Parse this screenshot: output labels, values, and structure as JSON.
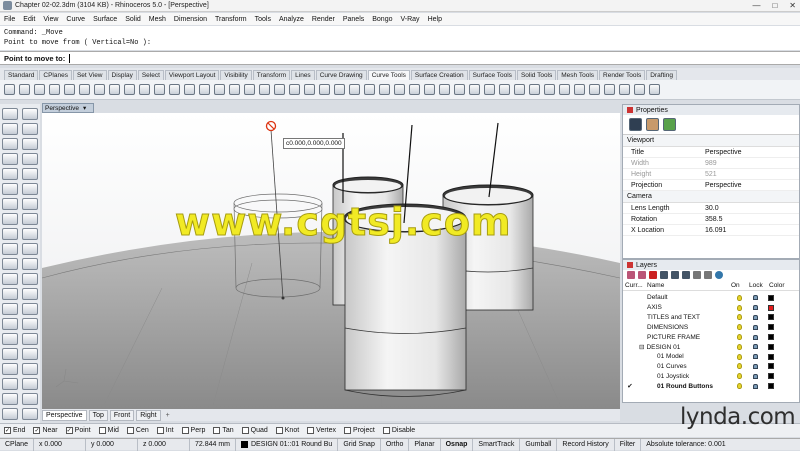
{
  "window": {
    "title": "Chapter 02-02.3dm (3104 KB) - Rhinoceros 5.0 - [Perspective]",
    "controls": [
      "—",
      "□",
      "✕"
    ]
  },
  "menu": [
    "File",
    "Edit",
    "View",
    "Curve",
    "Surface",
    "Solid",
    "Mesh",
    "Dimension",
    "Transform",
    "Tools",
    "Analyze",
    "Render",
    "Panels",
    "Bongo",
    "V-Ray",
    "Help"
  ],
  "command": {
    "history": [
      "Command: _Move",
      "Point to move from ( Vertical=No ):"
    ],
    "prompt": "Point to move to:"
  },
  "toolbar_tabs": [
    "Standard",
    "CPlanes",
    "Set View",
    "Display",
    "Select",
    "Viewport Layout",
    "Visibility",
    "Transform",
    "Lines",
    "Curve Drawing",
    "Curve Tools",
    "Surface Creation",
    "Surface Tools",
    "Solid Tools",
    "Mesh Tools",
    "Render Tools",
    "Drafting"
  ],
  "active_toolbar_tab": "Curve Tools",
  "viewport": {
    "label": "Perspective",
    "coord_tooltip": "c0.000,0.000,0.000",
    "watermark": "www.cgtsj.com",
    "tabs": [
      "Perspective",
      "Top",
      "Front",
      "Right"
    ],
    "add_tab": "+"
  },
  "osnap": [
    {
      "label": "End",
      "checked": true
    },
    {
      "label": "Near",
      "checked": true
    },
    {
      "label": "Point",
      "checked": true
    },
    {
      "label": "Mid",
      "checked": false
    },
    {
      "label": "Cen",
      "checked": false
    },
    {
      "label": "Int",
      "checked": false
    },
    {
      "label": "Perp",
      "checked": false
    },
    {
      "label": "Tan",
      "checked": false
    },
    {
      "label": "Quad",
      "checked": false
    },
    {
      "label": "Knot",
      "checked": false
    },
    {
      "label": "Vertex",
      "checked": false
    },
    {
      "label": "Project",
      "checked": false
    },
    {
      "label": "Disable",
      "checked": false
    }
  ],
  "status": {
    "cplane": "CPlane",
    "x": "x 0.000",
    "y": "y 0.000",
    "z": "z 0.000",
    "dist": "72.844 mm",
    "layer": "DESIGN 01::01 Round Bu",
    "grid_snap": "Grid Snap",
    "ortho": "Ortho",
    "planar": "Planar",
    "osnap": "Osnap",
    "smarttrack": "SmartTrack",
    "gumball": "Gumball",
    "record_history": "Record History",
    "filter": "Filter",
    "tolerance": "Absolute tolerance: 0.001"
  },
  "properties": {
    "header": "Properties",
    "section_viewport": "Viewport",
    "rows": [
      {
        "k": "Title",
        "v": "Perspective",
        "dim": false
      },
      {
        "k": "Width",
        "v": "989",
        "dim": true
      },
      {
        "k": "Height",
        "v": "521",
        "dim": true
      },
      {
        "k": "Projection",
        "v": "Perspective",
        "dim": false
      }
    ],
    "section_camera": "Camera",
    "camera_rows": [
      {
        "k": "Lens Length",
        "v": "30.0"
      },
      {
        "k": "Rotation",
        "v": "358.5"
      },
      {
        "k": "X Location",
        "v": "16.091"
      }
    ]
  },
  "layers": {
    "header": "Layers",
    "columns": [
      "Curr...",
      "Name",
      "On",
      "Lock",
      "Color"
    ],
    "rows": [
      {
        "name": "Default",
        "indent": 0,
        "current": false,
        "color": "#000000",
        "bold": false
      },
      {
        "name": "AXIS",
        "indent": 0,
        "current": false,
        "color": "#e31c1c",
        "bold": false
      },
      {
        "name": "TITLES and TEXT",
        "indent": 0,
        "current": false,
        "color": "#000000",
        "bold": false
      },
      {
        "name": "DIMENSIONS",
        "indent": 0,
        "current": false,
        "color": "#000000",
        "bold": false
      },
      {
        "name": "PICTURE FRAME",
        "indent": 0,
        "current": false,
        "color": "#000000",
        "bold": false
      },
      {
        "name": "DESIGN 01",
        "indent": 0,
        "current": false,
        "color": "#000000",
        "bold": false,
        "expander": "⊟"
      },
      {
        "name": "01 Model",
        "indent": 1,
        "current": false,
        "color": "#000000",
        "bold": false
      },
      {
        "name": "01 Curves",
        "indent": 1,
        "current": false,
        "color": "#000000",
        "bold": false
      },
      {
        "name": "01 Joystick",
        "indent": 1,
        "current": false,
        "color": "#000000",
        "bold": false
      },
      {
        "name": "01 Round Buttons",
        "indent": 1,
        "current": true,
        "color": "#000000",
        "bold": true
      }
    ],
    "current_mark": "✔"
  },
  "branding": "lynda.com"
}
